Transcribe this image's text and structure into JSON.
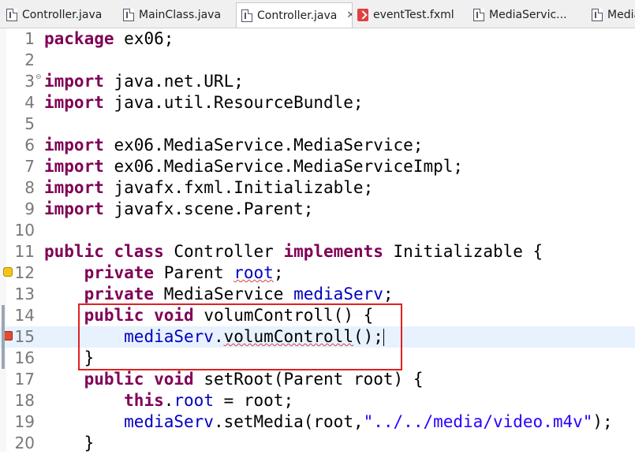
{
  "tabs": [
    {
      "label": "Controller.java",
      "icon": "java-file-icon",
      "active": false
    },
    {
      "label": "MainClass.java",
      "icon": "java-file-icon",
      "active": false
    },
    {
      "label": "Controller.java",
      "icon": "java-file-icon",
      "active": true,
      "close": "✕"
    },
    {
      "label": "eventTest.fxml",
      "icon": "fxml-file-icon",
      "active": false
    },
    {
      "label": "MediaServic...",
      "icon": "java-file-icon",
      "active": false
    },
    {
      "label": "Media",
      "icon": "java-file-icon",
      "active": false
    }
  ],
  "editor": {
    "line_numbers": [
      "1",
      "2",
      "3",
      "4",
      "5",
      "6",
      "7",
      "8",
      "9",
      "10",
      "11",
      "12",
      "13",
      "14",
      "15",
      "16",
      "17",
      "18",
      "19",
      "20"
    ],
    "lines": [
      [
        {
          "t": "package",
          "c": "kw"
        },
        {
          "t": " ex06;"
        }
      ],
      [],
      [
        {
          "t": "import",
          "c": "kw"
        },
        {
          "t": " java.net.URL;"
        }
      ],
      [
        {
          "t": "import",
          "c": "kw"
        },
        {
          "t": " java.util.ResourceBundle;"
        }
      ],
      [],
      [
        {
          "t": "import",
          "c": "kw"
        },
        {
          "t": " ex06.MediaService.MediaService;"
        }
      ],
      [
        {
          "t": "import",
          "c": "kw"
        },
        {
          "t": " ex06.MediaService.MediaServiceImpl;"
        }
      ],
      [
        {
          "t": "import",
          "c": "kw"
        },
        {
          "t": " javafx.fxml.Initializable;"
        }
      ],
      [
        {
          "t": "import",
          "c": "kw"
        },
        {
          "t": " javafx.scene.Parent;"
        }
      ],
      [],
      [
        {
          "t": "public",
          "c": "kw"
        },
        {
          "t": " "
        },
        {
          "t": "class",
          "c": "kw"
        },
        {
          "t": " Controller "
        },
        {
          "t": "implements",
          "c": "kw"
        },
        {
          "t": " Initializable {"
        }
      ],
      [
        {
          "t": "    "
        },
        {
          "t": "private",
          "c": "kw"
        },
        {
          "t": " Parent "
        },
        {
          "t": "root",
          "c": "fld squiggle"
        },
        {
          "t": ";"
        }
      ],
      [
        {
          "t": "    "
        },
        {
          "t": "private",
          "c": "kw"
        },
        {
          "t": " MediaService "
        },
        {
          "t": "mediaServ",
          "c": "fld"
        },
        {
          "t": ";"
        }
      ],
      [
        {
          "t": "    "
        },
        {
          "t": "public",
          "c": "kw"
        },
        {
          "t": " "
        },
        {
          "t": "void",
          "c": "kw"
        },
        {
          "t": " volumControll() {"
        }
      ],
      [
        {
          "t": "        "
        },
        {
          "t": "mediaServ",
          "c": "fld"
        },
        {
          "t": "."
        },
        {
          "t": "volumControll",
          "c": "squiggle"
        },
        {
          "t": "();"
        },
        {
          "caret": true
        }
      ],
      [
        {
          "t": "    }"
        }
      ],
      [
        {
          "t": "    "
        },
        {
          "t": "public",
          "c": "kw"
        },
        {
          "t": " "
        },
        {
          "t": "void",
          "c": "kw"
        },
        {
          "t": " setRoot(Parent root) {"
        }
      ],
      [
        {
          "t": "        "
        },
        {
          "t": "this",
          "c": "kw"
        },
        {
          "t": "."
        },
        {
          "t": "root",
          "c": "fld"
        },
        {
          "t": " = root;"
        }
      ],
      [
        {
          "t": "        "
        },
        {
          "t": "mediaServ",
          "c": "fld"
        },
        {
          "t": ".setMedia(root,"
        },
        {
          "t": "\"../../media/video.m4v\"",
          "c": "str"
        },
        {
          "t": ");"
        }
      ],
      [
        {
          "t": "    }"
        }
      ]
    ],
    "current_line": 15,
    "fold_markers": {
      "3": "⊖"
    },
    "warning_lines": [
      12
    ],
    "error_lines": [
      15
    ],
    "highlighted_lines": [
      14,
      16
    ]
  }
}
